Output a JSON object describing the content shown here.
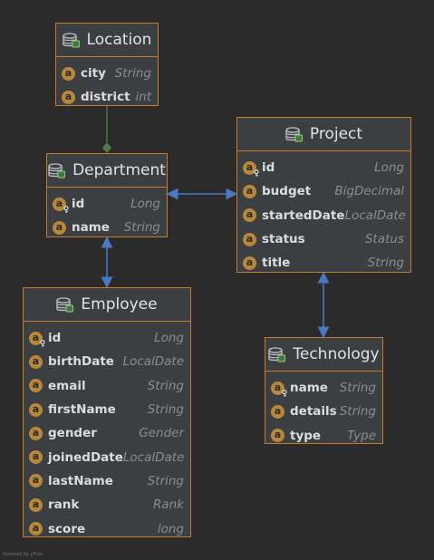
{
  "colors": {
    "background": "#2b2b2b",
    "entity_border": "#c57a2c",
    "entity_fill": "#3c3f41",
    "field_badge": "#b9873a",
    "composition_link": "#4f7f45",
    "association_link": "#4a78c1"
  },
  "entities": [
    {
      "id": "location",
      "title": "Location",
      "title_icon": "table-icon",
      "fields": [
        {
          "name": "city",
          "type": "String",
          "pk": false
        },
        {
          "name": "district",
          "type": "int",
          "pk": false
        }
      ]
    },
    {
      "id": "department",
      "title": "Department",
      "title_icon": "table-icon",
      "fields": [
        {
          "name": "id",
          "type": "Long",
          "pk": true
        },
        {
          "name": "name",
          "type": "String",
          "pk": false
        }
      ]
    },
    {
      "id": "project",
      "title": "Project",
      "title_icon": "table-icon",
      "fields": [
        {
          "name": "id",
          "type": "Long",
          "pk": true
        },
        {
          "name": "budget",
          "type": "BigDecimal",
          "pk": false
        },
        {
          "name": "startedDate",
          "type": "LocalDate",
          "pk": false
        },
        {
          "name": "status",
          "type": "Status",
          "pk": false
        },
        {
          "name": "title",
          "type": "String",
          "pk": false
        }
      ]
    },
    {
      "id": "employee",
      "title": "Employee",
      "title_icon": "table-icon",
      "fields": [
        {
          "name": "id",
          "type": "Long",
          "pk": true
        },
        {
          "name": "birthDate",
          "type": "LocalDate",
          "pk": false
        },
        {
          "name": "email",
          "type": "String",
          "pk": false
        },
        {
          "name": "firstName",
          "type": "String",
          "pk": false
        },
        {
          "name": "gender",
          "type": "Gender",
          "pk": false
        },
        {
          "name": "joinedDate",
          "type": "LocalDate",
          "pk": false
        },
        {
          "name": "lastName",
          "type": "String",
          "pk": false
        },
        {
          "name": "rank",
          "type": "Rank",
          "pk": false
        },
        {
          "name": "score",
          "type": "long",
          "pk": false
        }
      ]
    },
    {
      "id": "technology",
      "title": "Technology",
      "title_icon": "table-icon",
      "fields": [
        {
          "name": "name",
          "type": "String",
          "pk": true
        },
        {
          "name": "details",
          "type": "String",
          "pk": false
        },
        {
          "name": "type",
          "type": "Type",
          "pk": false
        }
      ]
    }
  ],
  "relations": [
    {
      "from": "location",
      "to": "department",
      "kind": "composition"
    },
    {
      "from": "department",
      "to": "project",
      "kind": "association"
    },
    {
      "from": "department",
      "to": "employee",
      "kind": "association"
    },
    {
      "from": "project",
      "to": "technology",
      "kind": "association"
    }
  ],
  "footer": "Powered by yFiles"
}
